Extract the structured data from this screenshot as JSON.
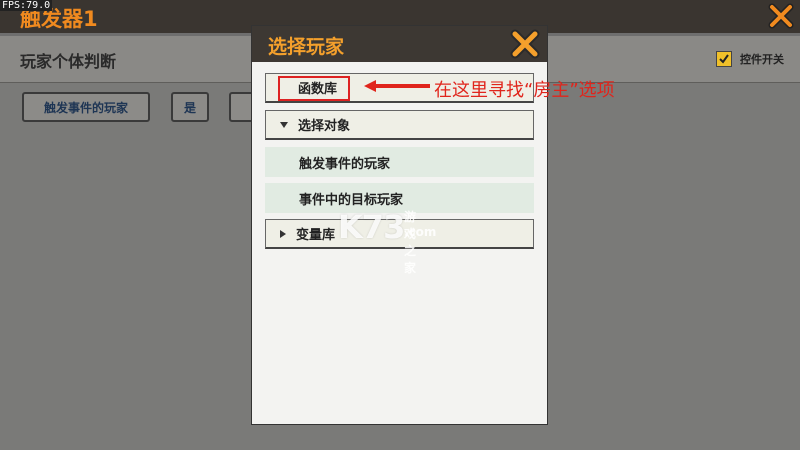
{
  "fps": "FPS:79.0",
  "app": {
    "title": "触发器1"
  },
  "panel": {
    "title": "玩家个体判断",
    "control_switch_label": "控件开关",
    "control_switch_checked": true,
    "buttons": [
      "触发事件的玩家",
      "是",
      ""
    ]
  },
  "modal": {
    "title": "选择玩家",
    "function_lib": "函数库",
    "select_target": "选择对象",
    "options": [
      "触发事件的玩家",
      "事件中的目标玩家"
    ],
    "variable_lib": "变量库"
  },
  "annotation": {
    "text": "在这里寻找“房主”选项",
    "color": "#e0251c"
  },
  "watermark": {
    "logo": "K73",
    "site": "游戏之家",
    "domain": ".com"
  },
  "colors": {
    "accent": "#f4a02c",
    "header_bg": "#3d3833",
    "sub_row_bg": "#e1ebe2"
  }
}
